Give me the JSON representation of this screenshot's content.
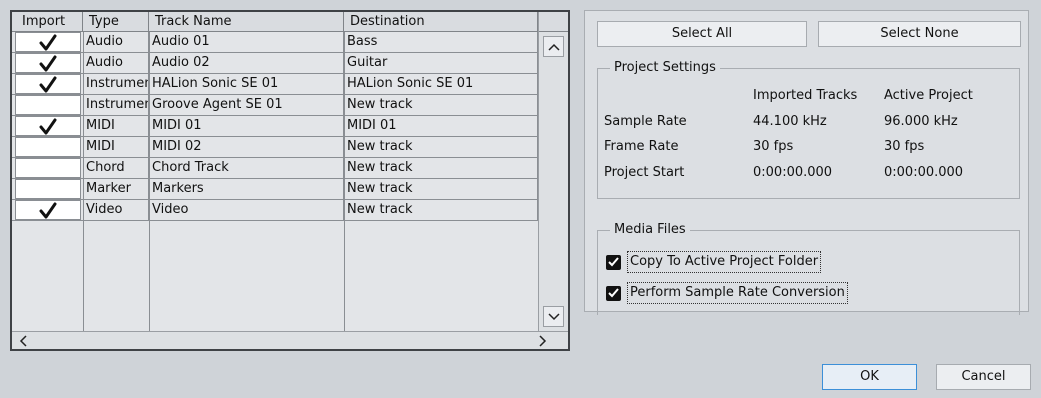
{
  "table": {
    "columns": [
      "Import",
      "Type",
      "Track Name",
      "Destination"
    ],
    "rows": [
      {
        "import": true,
        "type": "Audio",
        "name": "Audio 01",
        "dest": "Bass"
      },
      {
        "import": true,
        "type": "Audio",
        "name": "Audio 02",
        "dest": "Guitar"
      },
      {
        "import": true,
        "type": "Instrument",
        "name": "HALion Sonic SE 01",
        "dest": "HALion Sonic SE 01"
      },
      {
        "import": false,
        "type": "Instrument",
        "name": "Groove Agent SE 01",
        "dest": "New track"
      },
      {
        "import": true,
        "type": "MIDI",
        "name": "MIDI 01",
        "dest": "MIDI 01"
      },
      {
        "import": false,
        "type": "MIDI",
        "name": "MIDI 02",
        "dest": "New track"
      },
      {
        "import": false,
        "type": "Chord",
        "name": "Chord Track",
        "dest": "New track"
      },
      {
        "import": false,
        "type": "Marker",
        "name": "Markers",
        "dest": "New track"
      },
      {
        "import": true,
        "type": "Video",
        "name": "Video",
        "dest": "New track"
      }
    ]
  },
  "buttons": {
    "select_all": "Select All",
    "select_none": "Select None",
    "ok": "OK",
    "cancel": "Cancel"
  },
  "project_settings": {
    "title": "Project Settings",
    "col_imported": "Imported Tracks",
    "col_active": "Active Project",
    "rows": [
      {
        "label": "Sample Rate",
        "imported": "44.100 kHz",
        "active": "96.000 kHz"
      },
      {
        "label": "Frame Rate",
        "imported": "30 fps",
        "active": "30 fps"
      },
      {
        "label": "Project Start",
        "imported": "0:00:00.000",
        "active": "0:00:00.000"
      }
    ]
  },
  "media_files": {
    "title": "Media Files",
    "options": [
      {
        "label": "Copy To Active Project Folder",
        "checked": true
      },
      {
        "label": "Perform Sample Rate Conversion",
        "checked": true
      }
    ]
  },
  "colors": {
    "background": "#cfd3d8",
    "ok_border": "#3c8fd8"
  }
}
